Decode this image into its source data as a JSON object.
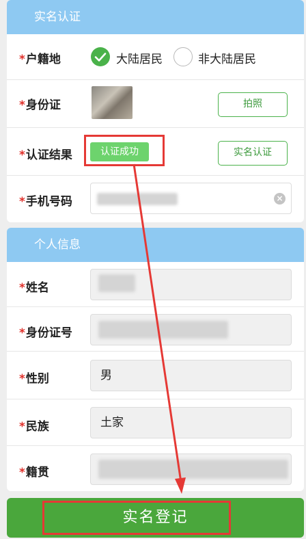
{
  "verify_section": {
    "title": "实名认证",
    "household": {
      "label": "户籍地",
      "option_mainland": "大陆居民",
      "option_non_mainland": "非大陆居民",
      "selected": "大陆居民"
    },
    "id_card": {
      "label": "身份证",
      "photo_button": "拍照"
    },
    "result": {
      "label": "认证结果",
      "badge": "认证成功",
      "verify_button": "实名认证"
    },
    "phone": {
      "label": "手机号码",
      "value": ""
    }
  },
  "personal_section": {
    "title": "个人信息",
    "name": {
      "label": "姓名",
      "value": ""
    },
    "id_number": {
      "label": "身份证号",
      "value": ""
    },
    "gender": {
      "label": "性别",
      "value": "男"
    },
    "ethnicity": {
      "label": "民族",
      "value": "土家"
    },
    "native_place": {
      "label": "籍贯",
      "value": ""
    }
  },
  "required_mark": "*",
  "submit_label": "实名登记",
  "colors": {
    "header": "#8ec9f2",
    "accent_green": "#4ab24a",
    "submit_green": "#4aa73c",
    "required_red": "#e0302a",
    "annotation_red": "#e53935"
  },
  "icons": {
    "checked": "checkmark-icon",
    "clear": "clear-icon"
  }
}
